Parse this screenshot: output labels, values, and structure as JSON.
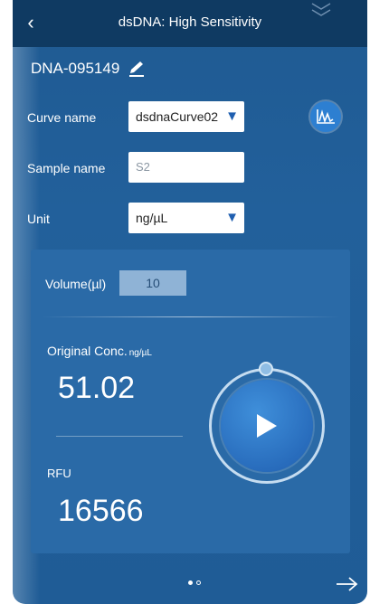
{
  "header": {
    "title": "dsDNA: High Sensitivity",
    "back_icon": "chevron-left-icon",
    "collapse_icon": "double-chevron-icon"
  },
  "sample": {
    "id": "DNA-095149",
    "edit_icon": "pencil-icon"
  },
  "form": {
    "curve_label": "Curve name",
    "curve_value": "dsdnaCurve02",
    "sample_label": "Sample name",
    "sample_placeholder": "S2",
    "unit_label": "Unit",
    "unit_value": "ng/µL",
    "curve_chart_icon": "curve-chart-icon"
  },
  "measurement": {
    "volume_label": "Volume(µl)",
    "volume_value": "10",
    "conc_label": "Original Conc.",
    "conc_unit": "ng/µL",
    "conc_value": "51.02",
    "rfu_label": "RFU",
    "rfu_value": "16566"
  },
  "pager": {
    "current_page": 1,
    "total_pages": 2
  },
  "colors": {
    "background": "#22609b",
    "header": "#0f3a62",
    "panel": "#2a6aa7",
    "accent": "#2d7fd1"
  }
}
